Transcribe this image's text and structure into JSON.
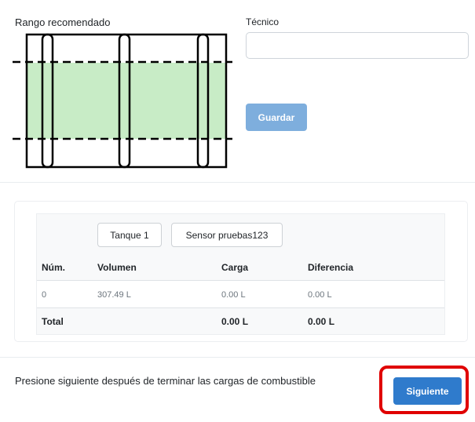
{
  "range": {
    "label": "Rango recomendado"
  },
  "technician": {
    "label": "Técnico",
    "value": "",
    "placeholder": ""
  },
  "save_button": {
    "label": "Guardar"
  },
  "tanks": {
    "tabs": [
      {
        "label": "Tanque 1"
      },
      {
        "label": "Sensor pruebas123"
      }
    ],
    "columns": [
      "Núm.",
      "Volumen",
      "Carga",
      "Diferencia"
    ],
    "rows": [
      {
        "num": "0",
        "volume": "307.49 L",
        "load": "0.00 L",
        "diff": "0.00 L"
      }
    ],
    "total": {
      "label": "Total",
      "load": "0.00 L",
      "diff": "0.00 L"
    }
  },
  "footer": {
    "message": "Presione siguiente después de terminar las cargas de combustible",
    "next_label": "Siguiente"
  },
  "colors": {
    "range_fill": "#c8ecc6",
    "primary": "#2f7bcc",
    "primary_disabled": "#7eaedd",
    "highlight": "#e00000"
  }
}
